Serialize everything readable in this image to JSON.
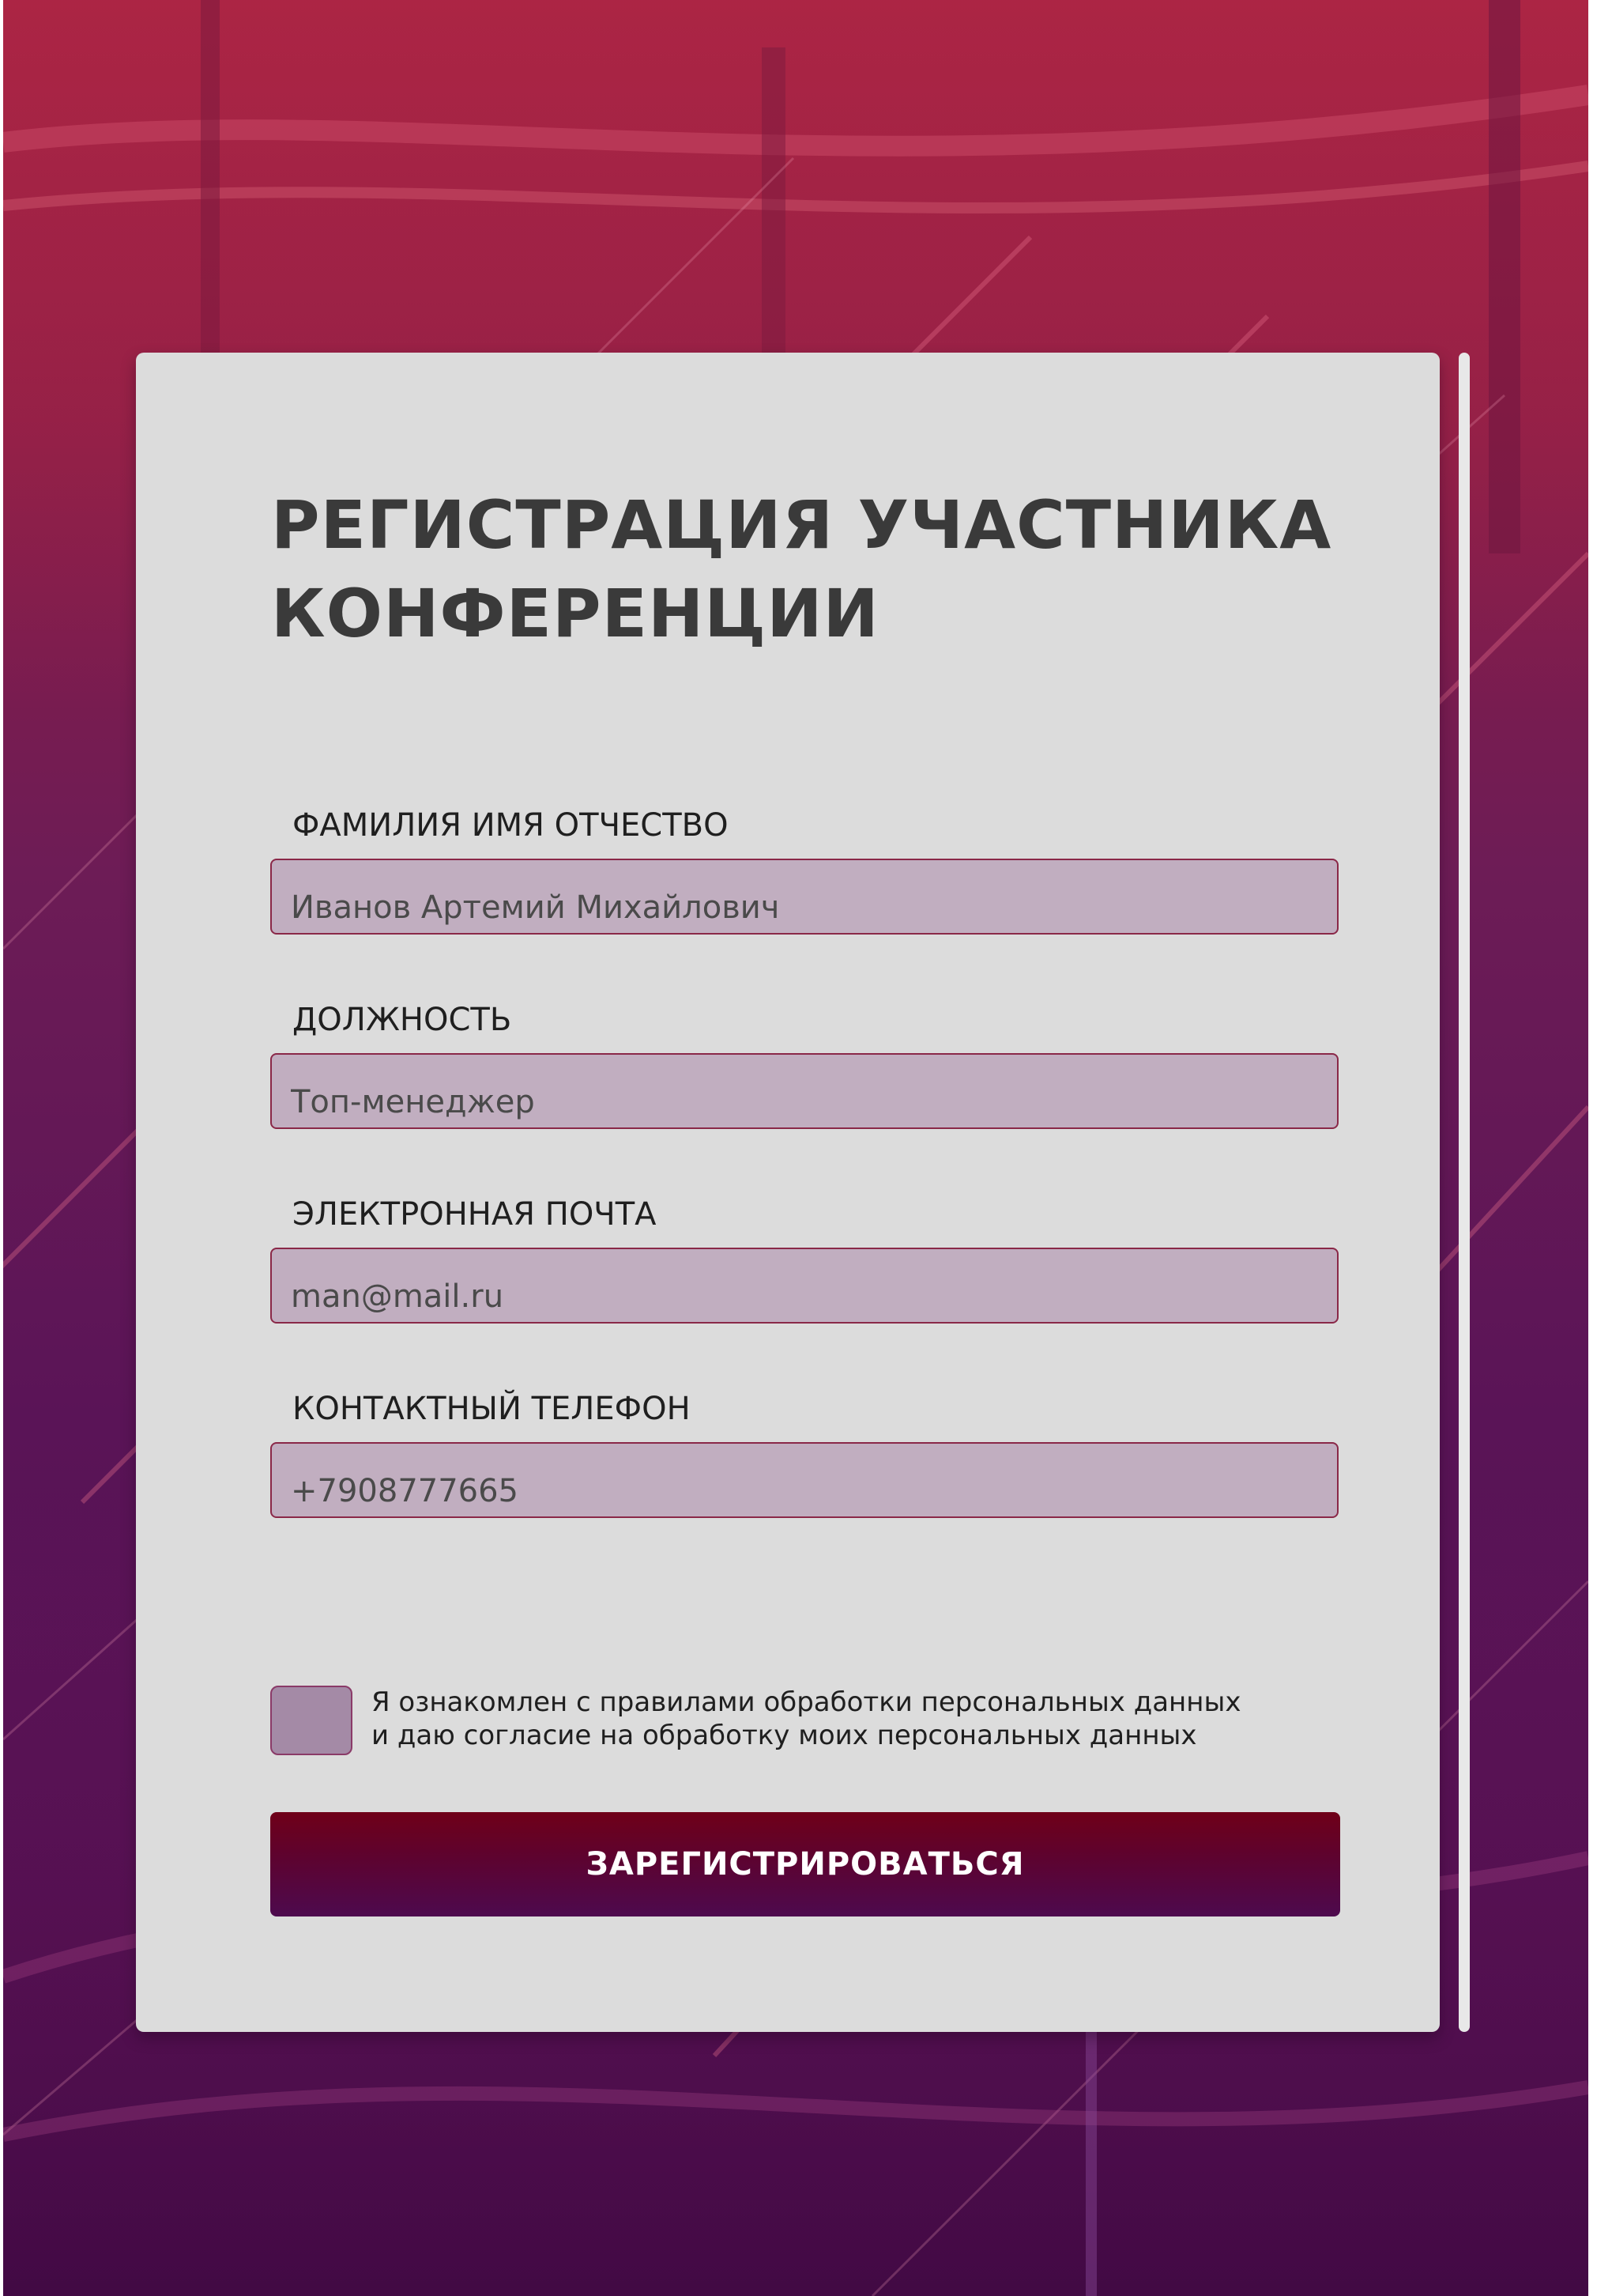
{
  "form": {
    "title_line1": "РЕГИСТРАЦИЯ УЧАСТНИКА",
    "title_line2": "КОНФЕРЕНЦИИ",
    "fields": [
      {
        "label": "ФАМИЛИЯ ИМЯ ОТЧЕСТВО",
        "value": "Иванов Артемий Михайлович"
      },
      {
        "label": "ДОЛЖНОСТЬ",
        "value": "Топ-менеджер"
      },
      {
        "label": "ЭЛЕКТРОННАЯ ПОЧТА",
        "value": "man@mail.ru"
      },
      {
        "label": "КОНТАКТНЫЙ ТЕЛЕФОН",
        "value": "+7908777665"
      }
    ],
    "consent": {
      "checked": false,
      "line1": "Я ознакомлен с правилами обработки персональных данных",
      "line2": "и даю согласие на обработку моих персональных данных"
    },
    "submit_label": "ЗАРЕГИСТРИРОВАТЬСЯ"
  },
  "colors": {
    "background_top": "#93183e",
    "background_bottom": "#4d0d4a",
    "card": "#dcdcdc",
    "input_fill": "#c1aec0",
    "input_border": "#8a2848",
    "button": "#5d0330"
  }
}
